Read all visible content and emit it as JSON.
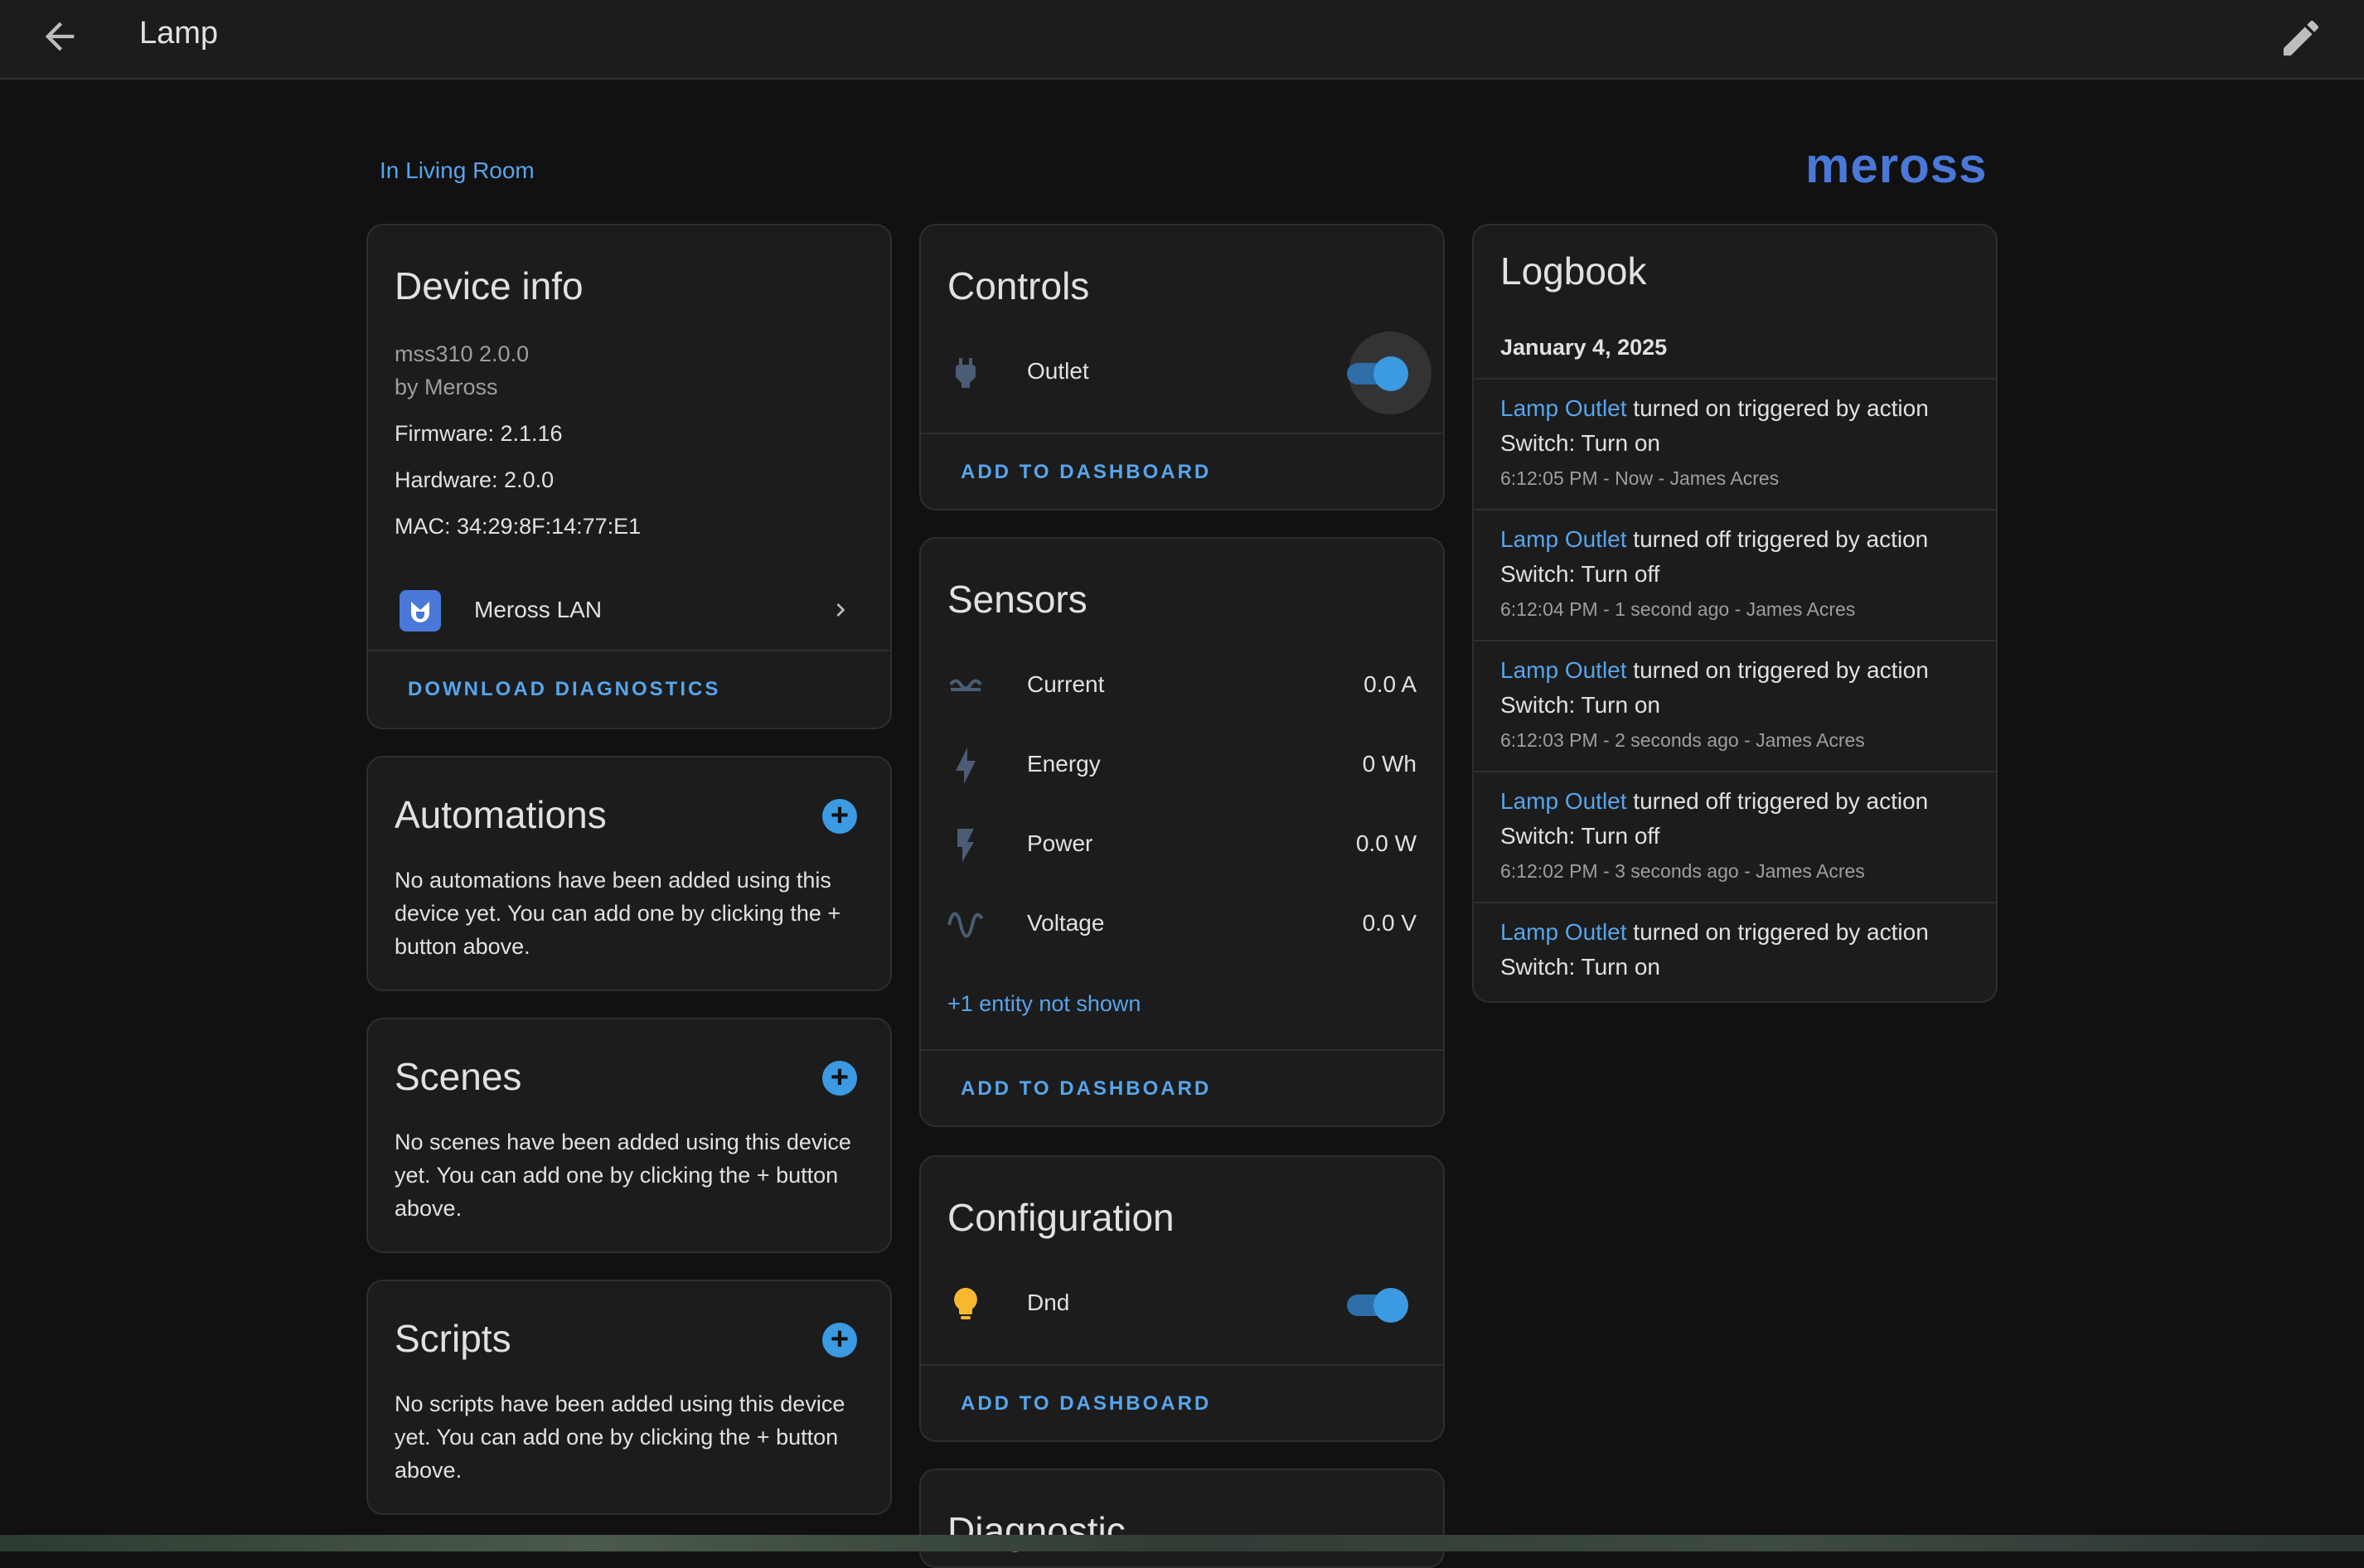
{
  "header": {
    "title": "Lamp"
  },
  "area_link": "In Living Room",
  "brand": "meross",
  "device_info": {
    "title": "Device info",
    "model": "mss310 2.0.0",
    "manufacturer": "by Meross",
    "firmware": "Firmware: 2.1.16",
    "hardware": "Hardware: 2.0.0",
    "mac": "MAC: 34:29:8F:14:77:E1",
    "integration": "Meross LAN",
    "download_label": "DOWNLOAD DIAGNOSTICS"
  },
  "automations": {
    "title": "Automations",
    "text": "No automations have been added using this device yet. You can add one by clicking the + button above."
  },
  "scenes": {
    "title": "Scenes",
    "text": "No scenes have been added using this device yet. You can add one by clicking the + button above."
  },
  "scripts": {
    "title": "Scripts",
    "text": "No scripts have been added using this device yet. You can add one by clicking the + button above."
  },
  "controls": {
    "title": "Controls",
    "outlet_label": "Outlet",
    "outlet_on": true,
    "add_label": "ADD TO DASHBOARD"
  },
  "sensors": {
    "title": "Sensors",
    "rows": [
      {
        "label": "Current",
        "value": "0.0 A",
        "icon": "current-ac-icon"
      },
      {
        "label": "Energy",
        "value": "0 Wh",
        "icon": "lightning-bolt-icon"
      },
      {
        "label": "Power",
        "value": "0.0 W",
        "icon": "flash-icon"
      },
      {
        "label": "Voltage",
        "value": "0.0 V",
        "icon": "sine-wave-icon"
      }
    ],
    "hidden_link": "+1 entity not shown",
    "add_label": "ADD TO DASHBOARD"
  },
  "configuration": {
    "title": "Configuration",
    "dnd_label": "Dnd",
    "dnd_on": true,
    "add_label": "ADD TO DASHBOARD"
  },
  "diagnostic": {
    "title": "Diagnostic"
  },
  "logbook": {
    "title": "Logbook",
    "date": "January 4, 2025",
    "entries": [
      {
        "entity": "Lamp Outlet",
        "text": " turned on triggered by action",
        "line2": "Switch: Turn on",
        "meta": "6:12:05 PM - Now - James Acres"
      },
      {
        "entity": "Lamp Outlet",
        "text": " turned off triggered by action",
        "line2": "Switch: Turn off",
        "meta": "6:12:04 PM - 1 second ago - James Acres"
      },
      {
        "entity": "Lamp Outlet",
        "text": " turned on triggered by action",
        "line2": "Switch: Turn on",
        "meta": "6:12:03 PM - 2 seconds ago - James Acres"
      },
      {
        "entity": "Lamp Outlet",
        "text": " turned off triggered by action",
        "line2": "Switch: Turn off",
        "meta": "6:12:02 PM - 3 seconds ago - James Acres"
      },
      {
        "entity": "Lamp Outlet",
        "text": " turned on triggered by action",
        "line2": "Switch: Turn on",
        "meta": ""
      }
    ]
  },
  "colors": {
    "accent": "#57a5ec",
    "toggle": "#3b9ae1",
    "background": "#111111",
    "card": "#1c1c1c",
    "bulb": "#f5b82e"
  }
}
